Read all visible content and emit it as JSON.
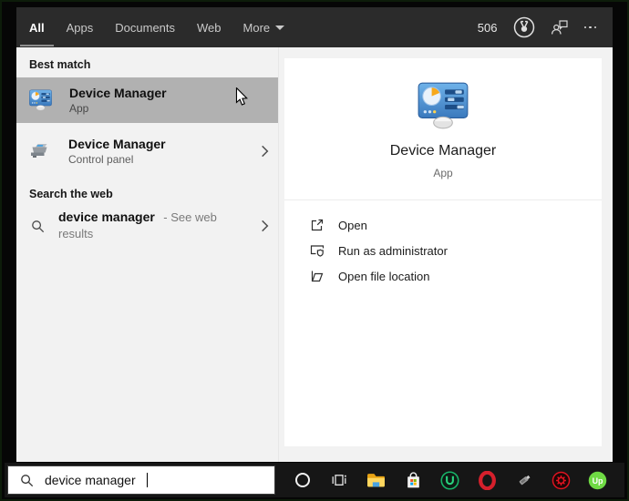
{
  "header": {
    "tabs": [
      {
        "label": "All",
        "selected": true
      },
      {
        "label": "Apps",
        "selected": false
      },
      {
        "label": "Documents",
        "selected": false
      },
      {
        "label": "Web",
        "selected": false
      },
      {
        "label": "More",
        "selected": false
      }
    ],
    "rewards_count": "506",
    "icons": [
      "rewards-medal-icon",
      "feedback-icon",
      "ellipsis-icon"
    ]
  },
  "results_panel": {
    "best_match_heading": "Best match",
    "best_match": {
      "title": "Device Manager",
      "subtitle": "App",
      "icon": "device-manager-icon"
    },
    "secondary_result": {
      "title": "Device Manager",
      "subtitle": "Control panel",
      "icon": "control-panel-device-icon"
    },
    "search_web_heading": "Search the web",
    "web_suggestion": {
      "query": "device manager",
      "hint": "- See web results",
      "icon": "search-icon"
    }
  },
  "preview": {
    "title": "Device Manager",
    "subtitle": "App",
    "icon": "device-manager-icon",
    "actions": [
      {
        "label": "Open",
        "icon": "launch-icon"
      },
      {
        "label": "Run as administrator",
        "icon": "admin-shield-icon"
      },
      {
        "label": "Open file location",
        "icon": "folder-open-icon"
      }
    ]
  },
  "search_bar": {
    "value": "device manager",
    "icon": "search-icon"
  },
  "taskbar": {
    "icons": [
      "cortana",
      "task-view",
      "file-explorer",
      "microsoft-store",
      "iobit-uninstaller",
      "opera",
      "usb-device",
      "driver-booster",
      "upwork"
    ],
    "upwork_monogram": "Up"
  },
  "colors": {
    "header_bg": "#2b2b2b",
    "panel_bg": "#f2f2f2",
    "selected_item_bg": "#b1b1b1",
    "card_bg": "#ffffff",
    "taskbar_bg": "#161616",
    "folder_yellow": "#f8b317",
    "opera_red": "#d6202c",
    "upwork_green": "#6fda44",
    "store_colors": [
      "#f25022",
      "#7fba00",
      "#00a4ef",
      "#ffb900"
    ]
  }
}
